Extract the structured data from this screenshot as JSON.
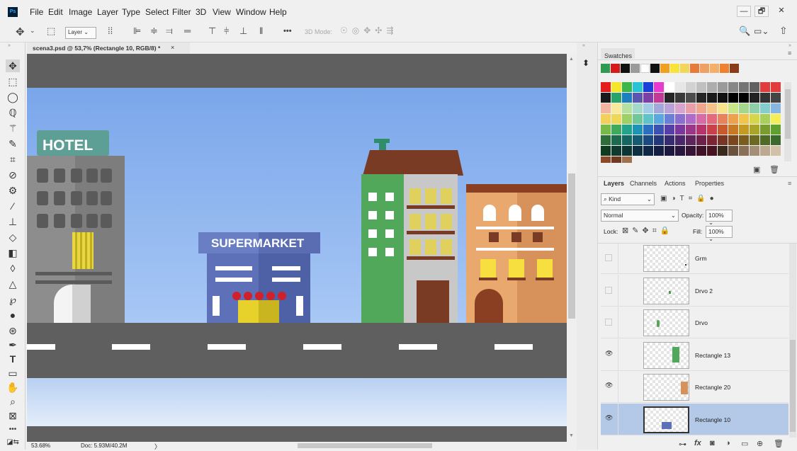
{
  "app": {
    "logo": "Ps"
  },
  "menu": [
    "File",
    "Edit",
    "Image",
    "Layer",
    "Type",
    "Select",
    "Filter",
    "3D",
    "View",
    "Window",
    "Help"
  ],
  "window": {
    "minimize": "—",
    "restore": "🗗",
    "close": "✕"
  },
  "options": {
    "move_icon": "✥",
    "layer_select": "Layer",
    "mode_label": "3D Mode:",
    "more": "•••",
    "search_icon": "🔍",
    "share_icon": "⇧"
  },
  "document": {
    "tab_title": "scena3.psd @ 53,7% (Rectangle 10, RGB/8) *",
    "close": "×"
  },
  "canvas": {
    "hotel_sign": "HOTEL",
    "supermarket_sign": "SUPERMARKET"
  },
  "status": {
    "zoom": "53.68%",
    "doc": "Doc: 5.93M/40.2M",
    "arrow": "〉"
  },
  "panels": {
    "swatches_title": "Swatches",
    "recent": [
      "#2e9a52",
      "#d51a1a",
      "#111111",
      "#9a9a9a",
      "#ffffff",
      "#111111",
      "#f0a020",
      "#f7e33a",
      "#f2d65a",
      "#e77b3b",
      "#f0a060",
      "#f2b06a",
      "#ef8030",
      "#8a3b1a"
    ],
    "layer_tabs": [
      "Layers",
      "Channels",
      "Actions",
      "Properties"
    ],
    "kind": "Kind",
    "blend_mode": "Normal",
    "opacity_label": "Opacity:",
    "opacity": "100%",
    "lock_label": "Lock:",
    "fill_label": "Fill:",
    "fill": "100%",
    "layers": [
      {
        "name": "Grm",
        "visible": false,
        "selected": false
      },
      {
        "name": "Drvo 2",
        "visible": false,
        "selected": false
      },
      {
        "name": "Drvo",
        "visible": false,
        "selected": false
      },
      {
        "name": "Rectangle 13",
        "visible": true,
        "selected": false
      },
      {
        "name": "Rectangle 20",
        "visible": true,
        "selected": false
      },
      {
        "name": "Rectangle 10",
        "visible": true,
        "selected": true
      }
    ],
    "footer_icons": [
      "link-icon",
      "fx-icon",
      "mask-icon",
      "adjustment-icon",
      "folder-icon",
      "new-layer-icon",
      "trash-icon"
    ]
  },
  "colors": {
    "accent": "#b4c9e8",
    "sky": "#8fb5ea",
    "road": "#5f5f5f"
  }
}
